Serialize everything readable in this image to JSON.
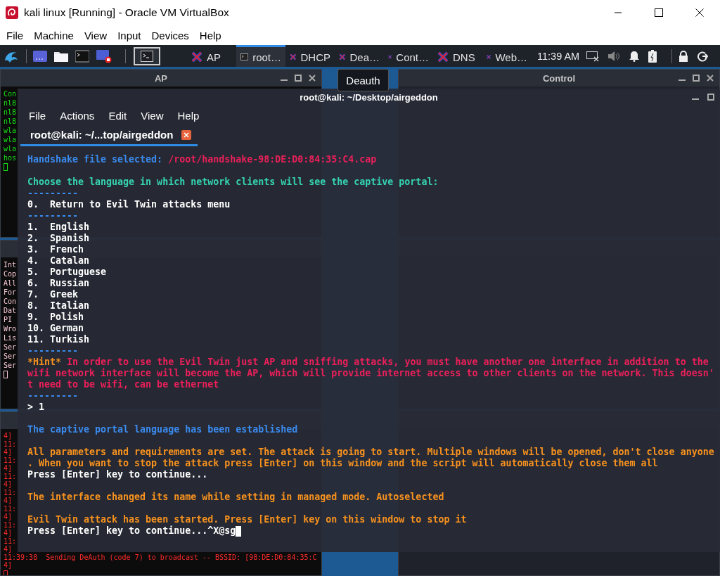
{
  "vm_window": {
    "title": "kali linux [Running] - Oracle VM VirtualBox",
    "menu": [
      "File",
      "Machine",
      "View",
      "Input",
      "Devices",
      "Help"
    ]
  },
  "panel": {
    "tasks": [
      {
        "label": "AP",
        "kind": "xterm",
        "selected": false
      },
      {
        "label": "root…",
        "kind": "terminal",
        "selected": true
      },
      {
        "label": "DHCP",
        "kind": "xterm",
        "selected": false
      },
      {
        "label": "Dea…",
        "kind": "xterm",
        "selected": false
      },
      {
        "label": "Cont…",
        "kind": "xterm",
        "selected": false
      },
      {
        "label": "DNS",
        "kind": "xterm",
        "selected": false
      },
      {
        "label": "Web…",
        "kind": "xterm",
        "selected": false
      }
    ],
    "clock": "11:39 AM"
  },
  "windows": [
    {
      "title": "AP",
      "kind": "hostapd",
      "lines": [
        {
          "kind": "text",
          "segments": [
            {
              "text": "Con",
              "kind": "green"
            }
          ]
        },
        {
          "kind": "text",
          "segments": [
            {
              "text": "nl8",
              "kind": "green"
            }
          ]
        },
        {
          "kind": "text",
          "segments": [
            {
              "text": "nl8",
              "kind": "green"
            }
          ]
        },
        {
          "kind": "text",
          "segments": [
            {
              "text": "nl8",
              "kind": "green"
            }
          ]
        },
        {
          "kind": "text",
          "segments": [
            {
              "text": "wla",
              "kind": "green"
            }
          ]
        },
        {
          "kind": "text",
          "segments": [
            {
              "text": "wla",
              "kind": "green"
            }
          ]
        },
        {
          "kind": "text",
          "segments": [
            {
              "text": "wla",
              "kind": "green"
            }
          ]
        },
        {
          "kind": "text",
          "segments": [
            {
              "text": "hos",
              "kind": "green"
            }
          ]
        },
        {
          "kind": "cursor"
        }
      ]
    },
    {
      "title": "Control",
      "kind": "control"
    },
    {
      "kind": "dhcp",
      "lines": [
        {
          "kind": "text",
          "segments": [
            {
              "text": "Int",
              "kind": "pink"
            }
          ]
        },
        {
          "kind": "text",
          "segments": [
            {
              "text": "Cop",
              "kind": "pink"
            }
          ]
        },
        {
          "kind": "text",
          "segments": [
            {
              "text": "All",
              "kind": "pink"
            }
          ]
        },
        {
          "kind": "text",
          "segments": [
            {
              "text": "For",
              "kind": "pink"
            }
          ]
        },
        {
          "kind": "text",
          "segments": [
            {
              "text": "Con",
              "kind": "pink"
            }
          ]
        },
        {
          "kind": "text",
          "segments": [
            {
              "text": "Dat",
              "kind": "pink"
            }
          ]
        },
        {
          "kind": "text",
          "segments": [
            {
              "text": "PI",
              "kind": "pink"
            }
          ]
        },
        {
          "kind": "text",
          "segments": [
            {
              "text": "Wro",
              "kind": "pink"
            }
          ]
        },
        {
          "kind": "text",
          "segments": [
            {
              "text": "Lis",
              "kind": "pink"
            }
          ]
        },
        {
          "kind": "text",
          "segments": [
            {
              "text": "Ser",
              "kind": "pink"
            }
          ]
        },
        {
          "kind": "text",
          "segments": [
            {
              "text": "Ser",
              "kind": "pink"
            }
          ]
        },
        {
          "kind": "text",
          "segments": [
            {
              "text": "Ser",
              "kind": "pink"
            }
          ]
        },
        {
          "kind": "cursor"
        }
      ]
    },
    {
      "kind": "dns"
    },
    {
      "kind": "deauth",
      "lines": [
        {
          "kind": "text",
          "segments": [
            {
              "text": "4]",
              "kind": "red"
            }
          ]
        },
        {
          "kind": "text",
          "segments": [
            {
              "text": "11:",
              "kind": "red"
            }
          ]
        },
        {
          "kind": "text",
          "segments": [
            {
              "text": "4]",
              "kind": "red"
            }
          ]
        },
        {
          "kind": "text",
          "segments": [
            {
              "text": "11:",
              "kind": "red"
            }
          ]
        },
        {
          "kind": "text",
          "segments": [
            {
              "text": "4]",
              "kind": "red"
            }
          ]
        },
        {
          "kind": "text",
          "segments": [
            {
              "text": "11:",
              "kind": "red"
            }
          ]
        },
        {
          "kind": "text",
          "segments": [
            {
              "text": "4]",
              "kind": "red"
            }
          ]
        },
        {
          "kind": "text",
          "segments": [
            {
              "text": "11:",
              "kind": "red"
            }
          ]
        },
        {
          "kind": "text",
          "segments": [
            {
              "text": "4]",
              "kind": "red"
            }
          ]
        },
        {
          "kind": "text",
          "segments": [
            {
              "text": "11:",
              "kind": "red"
            }
          ]
        },
        {
          "kind": "text",
          "segments": [
            {
              "text": "4]",
              "kind": "red"
            }
          ]
        },
        {
          "kind": "text",
          "segments": [
            {
              "text": "11:",
              "kind": "red"
            }
          ]
        },
        {
          "kind": "text",
          "segments": [
            {
              "text": "4]",
              "kind": "red"
            }
          ]
        },
        {
          "kind": "text",
          "segments": [
            {
              "text": "11:",
              "kind": "red"
            }
          ]
        },
        {
          "kind": "text",
          "segments": [
            {
              "text": "4]",
              "kind": "red"
            }
          ]
        },
        {
          "kind": "text",
          "segments": [
            {
              "text": "11:39:38  Sending DeAuth (code 7) to broadcast -- BSSID: [98:DE:D0:84:35:C",
              "kind": "red"
            }
          ]
        },
        {
          "kind": "text",
          "segments": [
            {
              "text": "4]",
              "kind": "red"
            }
          ]
        },
        {
          "kind": "cursor"
        }
      ]
    },
    {
      "kind": "webserver"
    }
  ],
  "tooltip": "Deauth",
  "terminal": {
    "title": "root@kali: ~/Desktop/airgeddon",
    "menu": [
      "File",
      "Actions",
      "Edit",
      "View",
      "Help"
    ],
    "tab": {
      "label": "root@kali: ~/...top/airgeddon",
      "selected": true
    },
    "lines": [
      {
        "kind": "text",
        "segments": [
          {
            "text": "Handshake file selected:",
            "kind": "blue"
          },
          {
            "text": " /root/handshake-98:DE:D0:84:35:C4.cap",
            "kind": "red"
          }
        ]
      },
      {
        "kind": "blank"
      },
      {
        "kind": "text",
        "segments": [
          {
            "text": "Choose the language in which network clients will see the captive portal:",
            "kind": "teal"
          }
        ]
      },
      {
        "kind": "text",
        "segments": [
          {
            "text": "---------",
            "kind": "blue"
          }
        ]
      },
      {
        "kind": "text",
        "segments": [
          {
            "text": "0.  Return to Evil Twin attacks menu",
            "kind": "white"
          }
        ]
      },
      {
        "kind": "text",
        "segments": [
          {
            "text": "---------",
            "kind": "blue"
          }
        ]
      },
      {
        "kind": "text",
        "segments": [
          {
            "text": "1.  English",
            "kind": "white"
          }
        ]
      },
      {
        "kind": "text",
        "segments": [
          {
            "text": "2.  Spanish",
            "kind": "white"
          }
        ]
      },
      {
        "kind": "text",
        "segments": [
          {
            "text": "3.  French",
            "kind": "white"
          }
        ]
      },
      {
        "kind": "text",
        "segments": [
          {
            "text": "4.  Catalan",
            "kind": "white"
          }
        ]
      },
      {
        "kind": "text",
        "segments": [
          {
            "text": "5.  Portuguese",
            "kind": "white"
          }
        ]
      },
      {
        "kind": "text",
        "segments": [
          {
            "text": "6.  Russian",
            "kind": "white"
          }
        ]
      },
      {
        "kind": "text",
        "segments": [
          {
            "text": "7.  Greek",
            "kind": "white"
          }
        ]
      },
      {
        "kind": "text",
        "segments": [
          {
            "text": "8.  Italian",
            "kind": "white"
          }
        ]
      },
      {
        "kind": "text",
        "segments": [
          {
            "text": "9.  Polish",
            "kind": "white"
          }
        ]
      },
      {
        "kind": "text",
        "segments": [
          {
            "text": "10. German",
            "kind": "white"
          }
        ]
      },
      {
        "kind": "text",
        "segments": [
          {
            "text": "11. Turkish",
            "kind": "white"
          }
        ]
      },
      {
        "kind": "text",
        "segments": [
          {
            "text": "---------",
            "kind": "blue"
          }
        ]
      },
      {
        "kind": "text",
        "segments": [
          {
            "text": "*Hint*",
            "kind": "orange"
          },
          {
            "text": " In order to use the Evil Twin just AP and sniffing attacks, you must have another one interface in addition to the",
            "kind": "red"
          }
        ]
      },
      {
        "kind": "text",
        "segments": [
          {
            "text": "wifi network interface will become the AP, which will provide internet access to other clients on the network. This doesn'",
            "kind": "red"
          }
        ]
      },
      {
        "kind": "text",
        "segments": [
          {
            "text": "t need to be wifi, can be ethernet",
            "kind": "red"
          }
        ]
      },
      {
        "kind": "text",
        "segments": [
          {
            "text": "---------",
            "kind": "blue"
          }
        ]
      },
      {
        "kind": "text",
        "segments": [
          {
            "text": "> 1",
            "kind": "white"
          }
        ]
      },
      {
        "kind": "blank"
      },
      {
        "kind": "text",
        "segments": [
          {
            "text": "The captive portal language has been established",
            "kind": "blue"
          }
        ]
      },
      {
        "kind": "blank"
      },
      {
        "kind": "text",
        "segments": [
          {
            "text": "All parameters and requirements are set. The attack is going to start. Multiple windows will be opened, don't close anyone",
            "kind": "orange"
          }
        ]
      },
      {
        "kind": "text",
        "segments": [
          {
            "text": ". When you want to stop the attack press [Enter] on this window and the script will automatically close them all",
            "kind": "orange"
          }
        ]
      },
      {
        "kind": "text",
        "segments": [
          {
            "text": "Press [Enter] key to continue...",
            "kind": "white"
          }
        ]
      },
      {
        "kind": "blank"
      },
      {
        "kind": "text",
        "segments": [
          {
            "text": "The interface changed its name while setting in managed mode. Autoselected",
            "kind": "orange"
          }
        ]
      },
      {
        "kind": "blank"
      },
      {
        "kind": "text",
        "segments": [
          {
            "text": "Evil Twin attack has been started. Press [Enter] key on this window to stop it",
            "kind": "orange"
          }
        ]
      },
      {
        "kind": "text",
        "cursor": true,
        "segments": [
          {
            "text": "Press [Enter] key to continue...^X@sg",
            "kind": "white"
          }
        ]
      }
    ]
  }
}
